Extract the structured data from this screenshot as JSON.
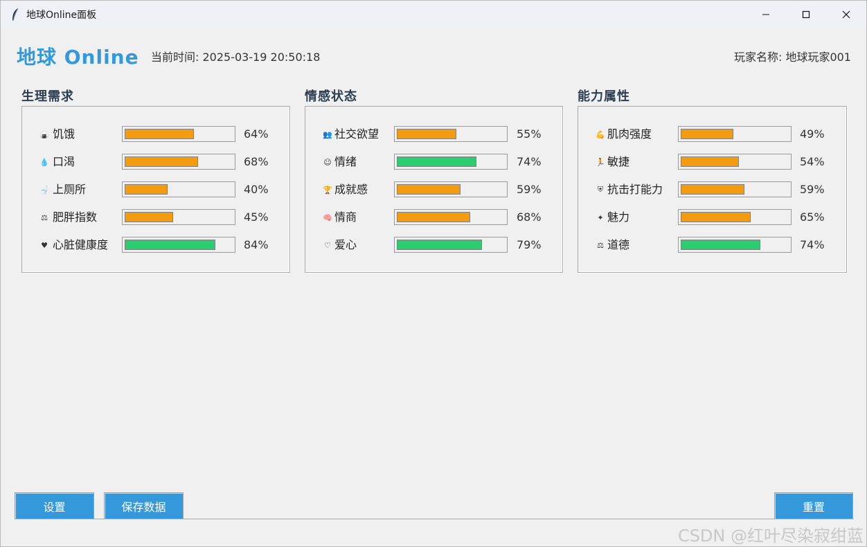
{
  "window": {
    "title": "地球Online面板"
  },
  "header": {
    "app_title": "地球 Online",
    "time_label": "当前时间: 2025-03-19 20:50:18",
    "player_label": "玩家名称: 地球玩家001"
  },
  "colors": {
    "accent": "#3498db",
    "title": "#3399dd",
    "bar_warn": "#f39c12",
    "bar_good": "#2ecc71"
  },
  "sections": [
    {
      "title": "生理需求",
      "stats": [
        {
          "icon": "food-icon",
          "label": "饥饿",
          "value": 64,
          "pct": "64%",
          "color": "#f39c12"
        },
        {
          "icon": "droplet-icon",
          "label": "口渴",
          "value": 68,
          "pct": "68%",
          "color": "#f39c12"
        },
        {
          "icon": "toilet-icon",
          "label": "上厕所",
          "value": 40,
          "pct": "40%",
          "color": "#f39c12"
        },
        {
          "icon": "scale-icon",
          "label": "肥胖指数",
          "value": 45,
          "pct": "45%",
          "color": "#f39c12"
        },
        {
          "icon": "heart-icon",
          "label": "心脏健康度",
          "value": 84,
          "pct": "84%",
          "color": "#2ecc71"
        }
      ]
    },
    {
      "title": "情感状态",
      "stats": [
        {
          "icon": "people-icon",
          "label": "社交欲望",
          "value": 55,
          "pct": "55%",
          "color": "#f39c12"
        },
        {
          "icon": "smile-icon",
          "label": "情绪",
          "value": 74,
          "pct": "74%",
          "color": "#2ecc71"
        },
        {
          "icon": "trophy-icon",
          "label": "成就感",
          "value": 59,
          "pct": "59%",
          "color": "#f39c12"
        },
        {
          "icon": "brain-icon",
          "label": "情商",
          "value": 68,
          "pct": "68%",
          "color": "#f39c12"
        },
        {
          "icon": "heart-hands-icon",
          "label": "爱心",
          "value": 79,
          "pct": "79%",
          "color": "#2ecc71"
        }
      ]
    },
    {
      "title": "能力属性",
      "stats": [
        {
          "icon": "muscle-icon",
          "label": "肌肉强度",
          "value": 49,
          "pct": "49%",
          "color": "#f39c12"
        },
        {
          "icon": "runner-icon",
          "label": "敏捷",
          "value": 54,
          "pct": "54%",
          "color": "#f39c12"
        },
        {
          "icon": "shield-icon",
          "label": "抗击打能力",
          "value": 59,
          "pct": "59%",
          "color": "#f39c12"
        },
        {
          "icon": "sparkle-icon",
          "label": "魅力",
          "value": 65,
          "pct": "65%",
          "color": "#f39c12"
        },
        {
          "icon": "balance-icon",
          "label": "道德",
          "value": 74,
          "pct": "74%",
          "color": "#2ecc71"
        }
      ]
    }
  ],
  "buttons": {
    "settings": "设置",
    "save": "保存数据",
    "reset": "重置"
  },
  "watermark": "CSDN @红叶尽染寂绀蓝"
}
